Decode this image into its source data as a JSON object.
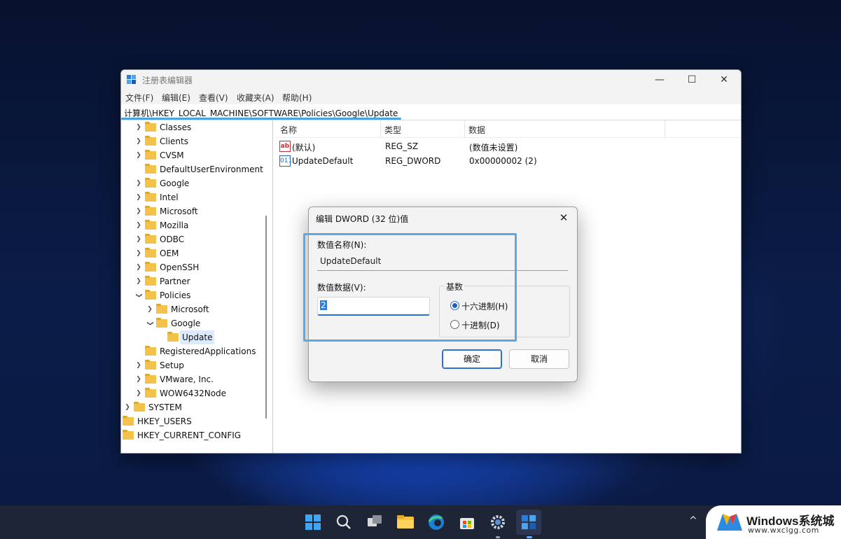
{
  "window": {
    "title": "注册表编辑器",
    "controls": {
      "minimize": "—",
      "maximize": "☐",
      "close": "✕"
    }
  },
  "menu": [
    "文件(F)",
    "编辑(E)",
    "查看(V)",
    "收藏夹(A)",
    "帮助(H)"
  ],
  "address": "计算机\\HKEY_LOCAL_MACHINE\\SOFTWARE\\Policies\\Google\\Update",
  "tree": [
    {
      "label": "Classes",
      "expander": "right"
    },
    {
      "label": "Clients",
      "expander": "right"
    },
    {
      "label": "CVSM",
      "expander": "right"
    },
    {
      "label": "DefaultUserEnvironment",
      "expander": "none"
    },
    {
      "label": "Google",
      "expander": "right"
    },
    {
      "label": "Intel",
      "expander": "right"
    },
    {
      "label": "Microsoft",
      "expander": "right"
    },
    {
      "label": "Mozilla",
      "expander": "right"
    },
    {
      "label": "ODBC",
      "expander": "right"
    },
    {
      "label": "OEM",
      "expander": "right"
    },
    {
      "label": "OpenSSH",
      "expander": "right"
    },
    {
      "label": "Partner",
      "expander": "right"
    },
    {
      "label": "Policies",
      "expander": "down"
    },
    {
      "label": "Microsoft",
      "expander": "right"
    },
    {
      "label": "Google",
      "expander": "down"
    },
    {
      "label": "Update",
      "expander": "none",
      "selected": true
    },
    {
      "label": "RegisteredApplications",
      "expander": "none"
    },
    {
      "label": "Setup",
      "expander": "right"
    },
    {
      "label": "VMware, Inc.",
      "expander": "right"
    },
    {
      "label": "WOW6432Node",
      "expander": "right"
    },
    {
      "label": "SYSTEM",
      "expander": "right"
    },
    {
      "label": "HKEY_USERS",
      "expander": "right"
    },
    {
      "label": "HKEY_CURRENT_CONFIG",
      "expander": "right"
    }
  ],
  "list": {
    "columns": [
      "名称",
      "类型",
      "数据"
    ],
    "rows": [
      {
        "icon": "ab",
        "name": "(默认)",
        "type": "REG_SZ",
        "data": "(数值未设置)"
      },
      {
        "icon": "dword",
        "name": "UpdateDefault",
        "type": "REG_DWORD",
        "data": "0x00000002 (2)"
      }
    ]
  },
  "dialog": {
    "title": "编辑 DWORD (32 位)值",
    "close": "✕",
    "name_label": "数值名称(N):",
    "name_value": "UpdateDefault",
    "data_label": "数值数据(V):",
    "data_value": "2",
    "base_label": "基数",
    "base_options": [
      {
        "label": "十六进制(H)",
        "checked": true
      },
      {
        "label": "十进制(D)",
        "checked": false
      }
    ],
    "ok": "确定",
    "cancel": "取消"
  },
  "taskbar": {
    "icons": [
      "start-icon",
      "search-icon",
      "task-view-icon",
      "file-explorer-icon",
      "edge-icon",
      "store-icon",
      "settings-icon",
      "regedit-icon"
    ],
    "tray_chevron": "^"
  },
  "watermark": {
    "title": "Windows系统城",
    "url": "www.wxclgg.com"
  },
  "colors": {
    "accent": "#2d6fd2",
    "highlight": "#5aa9e0",
    "folder": "#f2c24a",
    "taskbar": "#1d2537"
  }
}
